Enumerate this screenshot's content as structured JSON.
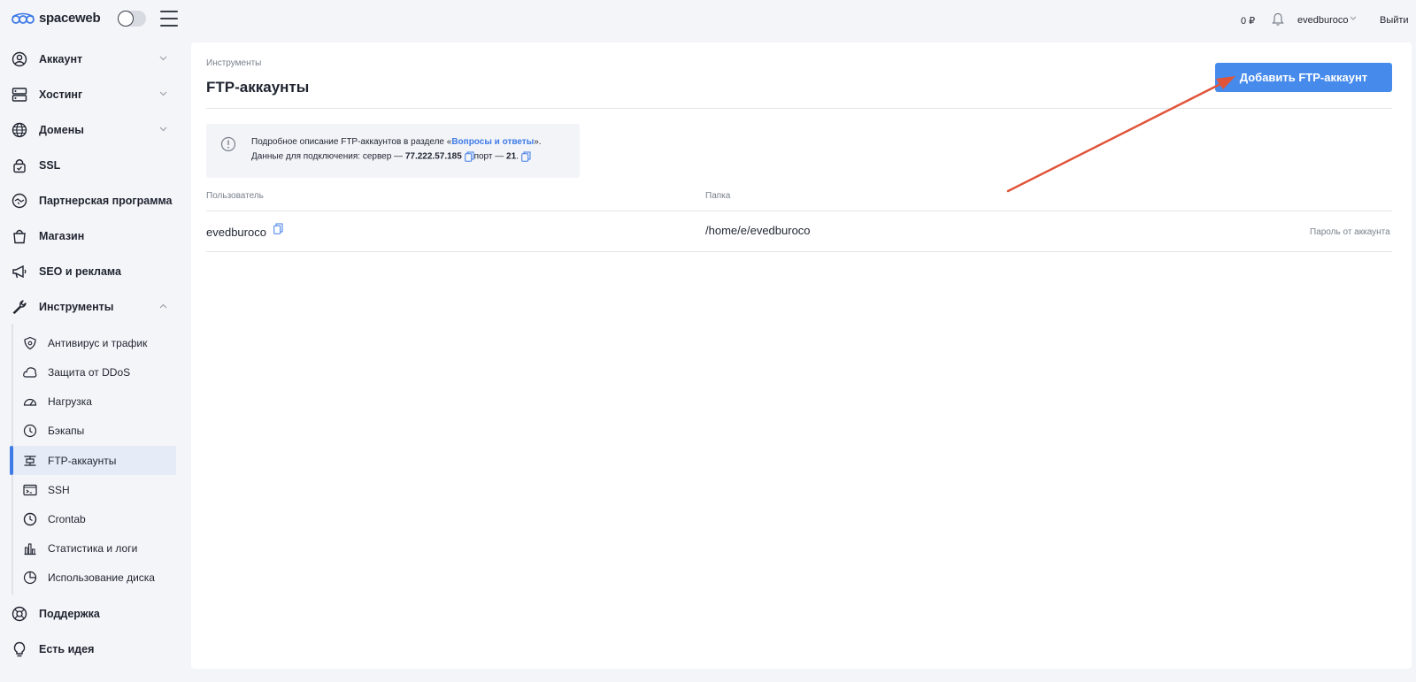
{
  "header": {
    "logo_text": "spaceweb",
    "balance": "0 ₽",
    "username": "evedburoco",
    "logout": "Выйти"
  },
  "sidebar": {
    "items": [
      {
        "label": "Аккаунт",
        "icon": "user-circle-icon"
      },
      {
        "label": "Хостинг",
        "icon": "server-icon"
      },
      {
        "label": "Домены",
        "icon": "globe-icon"
      },
      {
        "label": "SSL",
        "icon": "lock-icon"
      },
      {
        "label": "Партнерская программа",
        "icon": "handshake-icon"
      },
      {
        "label": "Магазин",
        "icon": "shopping-bag-icon"
      },
      {
        "label": "SEO и реклама",
        "icon": "megaphone-icon"
      },
      {
        "label": "Инструменты",
        "icon": "wrench-icon"
      }
    ],
    "subitems": [
      {
        "label": "Антивирус и трафик",
        "icon": "shield-icon"
      },
      {
        "label": "Защита от DDoS",
        "icon": "cloud-icon"
      },
      {
        "label": "Нагрузка",
        "icon": "gauge-icon"
      },
      {
        "label": "Бэкапы",
        "icon": "backup-icon"
      },
      {
        "label": "FTP-аккаунты",
        "icon": "ftp-icon"
      },
      {
        "label": "SSH",
        "icon": "terminal-icon"
      },
      {
        "label": "Crontab",
        "icon": "clock-icon"
      },
      {
        "label": "Статистика и логи",
        "icon": "bar-chart-icon"
      },
      {
        "label": "Использование диска",
        "icon": "disk-icon"
      }
    ],
    "bottom_items": [
      {
        "label": "Поддержка",
        "icon": "support-icon"
      },
      {
        "label": "Есть идея",
        "icon": "lightbulb-icon"
      }
    ]
  },
  "main": {
    "breadcrumb": "Инструменты",
    "title": "FTP-аккаунты",
    "add_button": "Добавить FTP-аккаунт",
    "info": {
      "line1_prefix": "Подробное описание FTP-аккаунтов в разделе «",
      "line1_link": "Вопросы и ответы",
      "line1_suffix": "».",
      "line2_prefix": "Данные для подключения: сервер — ",
      "server": "77.222.57.185",
      "port_label": "порт — ",
      "port": "21",
      "port_suffix": "."
    },
    "table": {
      "headers": [
        "Пользователь",
        "Папка"
      ],
      "rows": [
        {
          "user": "evedburoco",
          "folder": "/home/e/evedburoco",
          "action": "Пароль от аккаунта"
        }
      ]
    }
  },
  "colors": {
    "accent": "#468bec",
    "active_bg": "#e6ebf8",
    "arrow": "#e0543a"
  }
}
